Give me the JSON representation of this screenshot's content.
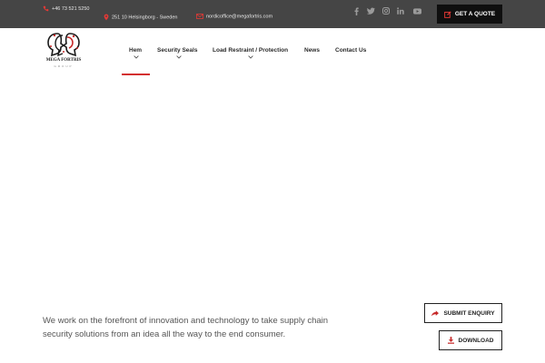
{
  "topbar": {
    "phone": "+46 73 521 5250",
    "address": "251 10 Helsingborg - Sweden",
    "email": "nordicoffice@megafortris.com",
    "quote_button": "GET A QUOTE"
  },
  "logo": {
    "name": "MEGA FORTRIS",
    "sub": "GROUP"
  },
  "nav": {
    "items": [
      {
        "label": "Hem"
      },
      {
        "label": "Security Seals"
      },
      {
        "label": "Load Restraint / Protection"
      },
      {
        "label": "News"
      },
      {
        "label": "Contact Us"
      }
    ]
  },
  "main": {
    "tagline": "We work on the forefront of innovation and technology to take supply chain security solutions from an idea all the way to the end consumer.",
    "enquiry_button": "SUBMIT ENQUIRY",
    "download_button": "DOWNLOAD"
  },
  "colors": {
    "topbar_bg": "#454545",
    "accent_red": "#d32f2f",
    "quote_bg": "#0f0f0f"
  }
}
